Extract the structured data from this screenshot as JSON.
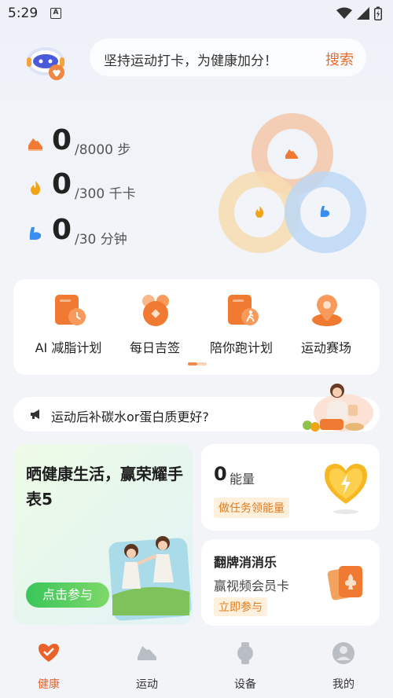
{
  "status_bar": {
    "time": "5:29",
    "notif_icon": "A"
  },
  "header": {
    "search_placeholder": "坚持运动打卡，为健康加分！",
    "search_button": "搜索"
  },
  "stats": [
    {
      "icon": "shoe-icon",
      "value": "0",
      "target": "/8000 步",
      "color": "#f07a32"
    },
    {
      "icon": "flame-icon",
      "value": "0",
      "target": "/300 千卡",
      "color": "#f2a417"
    },
    {
      "icon": "muscle-icon",
      "value": "0",
      "target": "/30 分钟",
      "color": "#3a8ef0"
    }
  ],
  "rings": {
    "colors": {
      "steps": "#f3c7a8",
      "calories": "#f7dcb0",
      "minutes": "#bcd7f5"
    },
    "progress": {
      "steps": 0,
      "calories": 0,
      "minutes": 0
    }
  },
  "quick_actions": [
    {
      "label": "AI 减脂计划",
      "icon": "plan-clock-icon"
    },
    {
      "label": "每日吉签",
      "icon": "lucky-coin-icon"
    },
    {
      "label": "陪你跑计划",
      "icon": "run-plan-icon"
    },
    {
      "label": "运动赛场",
      "icon": "location-pin-icon"
    }
  ],
  "quick_pager": {
    "pages": 2,
    "current": 1
  },
  "notice": {
    "text": "运动后补碳水or蛋白质更好?"
  },
  "promo": {
    "title": "晒健康生活，赢荣耀手表5",
    "button": "点击参与"
  },
  "energy": {
    "value": "0",
    "unit": "能量",
    "task_button": "做任务领能量"
  },
  "flip": {
    "title": "翻牌消消乐",
    "subtitle": "赢视频会员卡",
    "button": "立即参与"
  },
  "tabs": [
    {
      "label": "健康",
      "icon": "heart-icon",
      "active": true
    },
    {
      "label": "运动",
      "icon": "sneaker-icon",
      "active": false
    },
    {
      "label": "设备",
      "icon": "watch-icon",
      "active": false
    },
    {
      "label": "我的",
      "icon": "profile-icon",
      "active": false
    }
  ],
  "accent_color": "#e8622a"
}
